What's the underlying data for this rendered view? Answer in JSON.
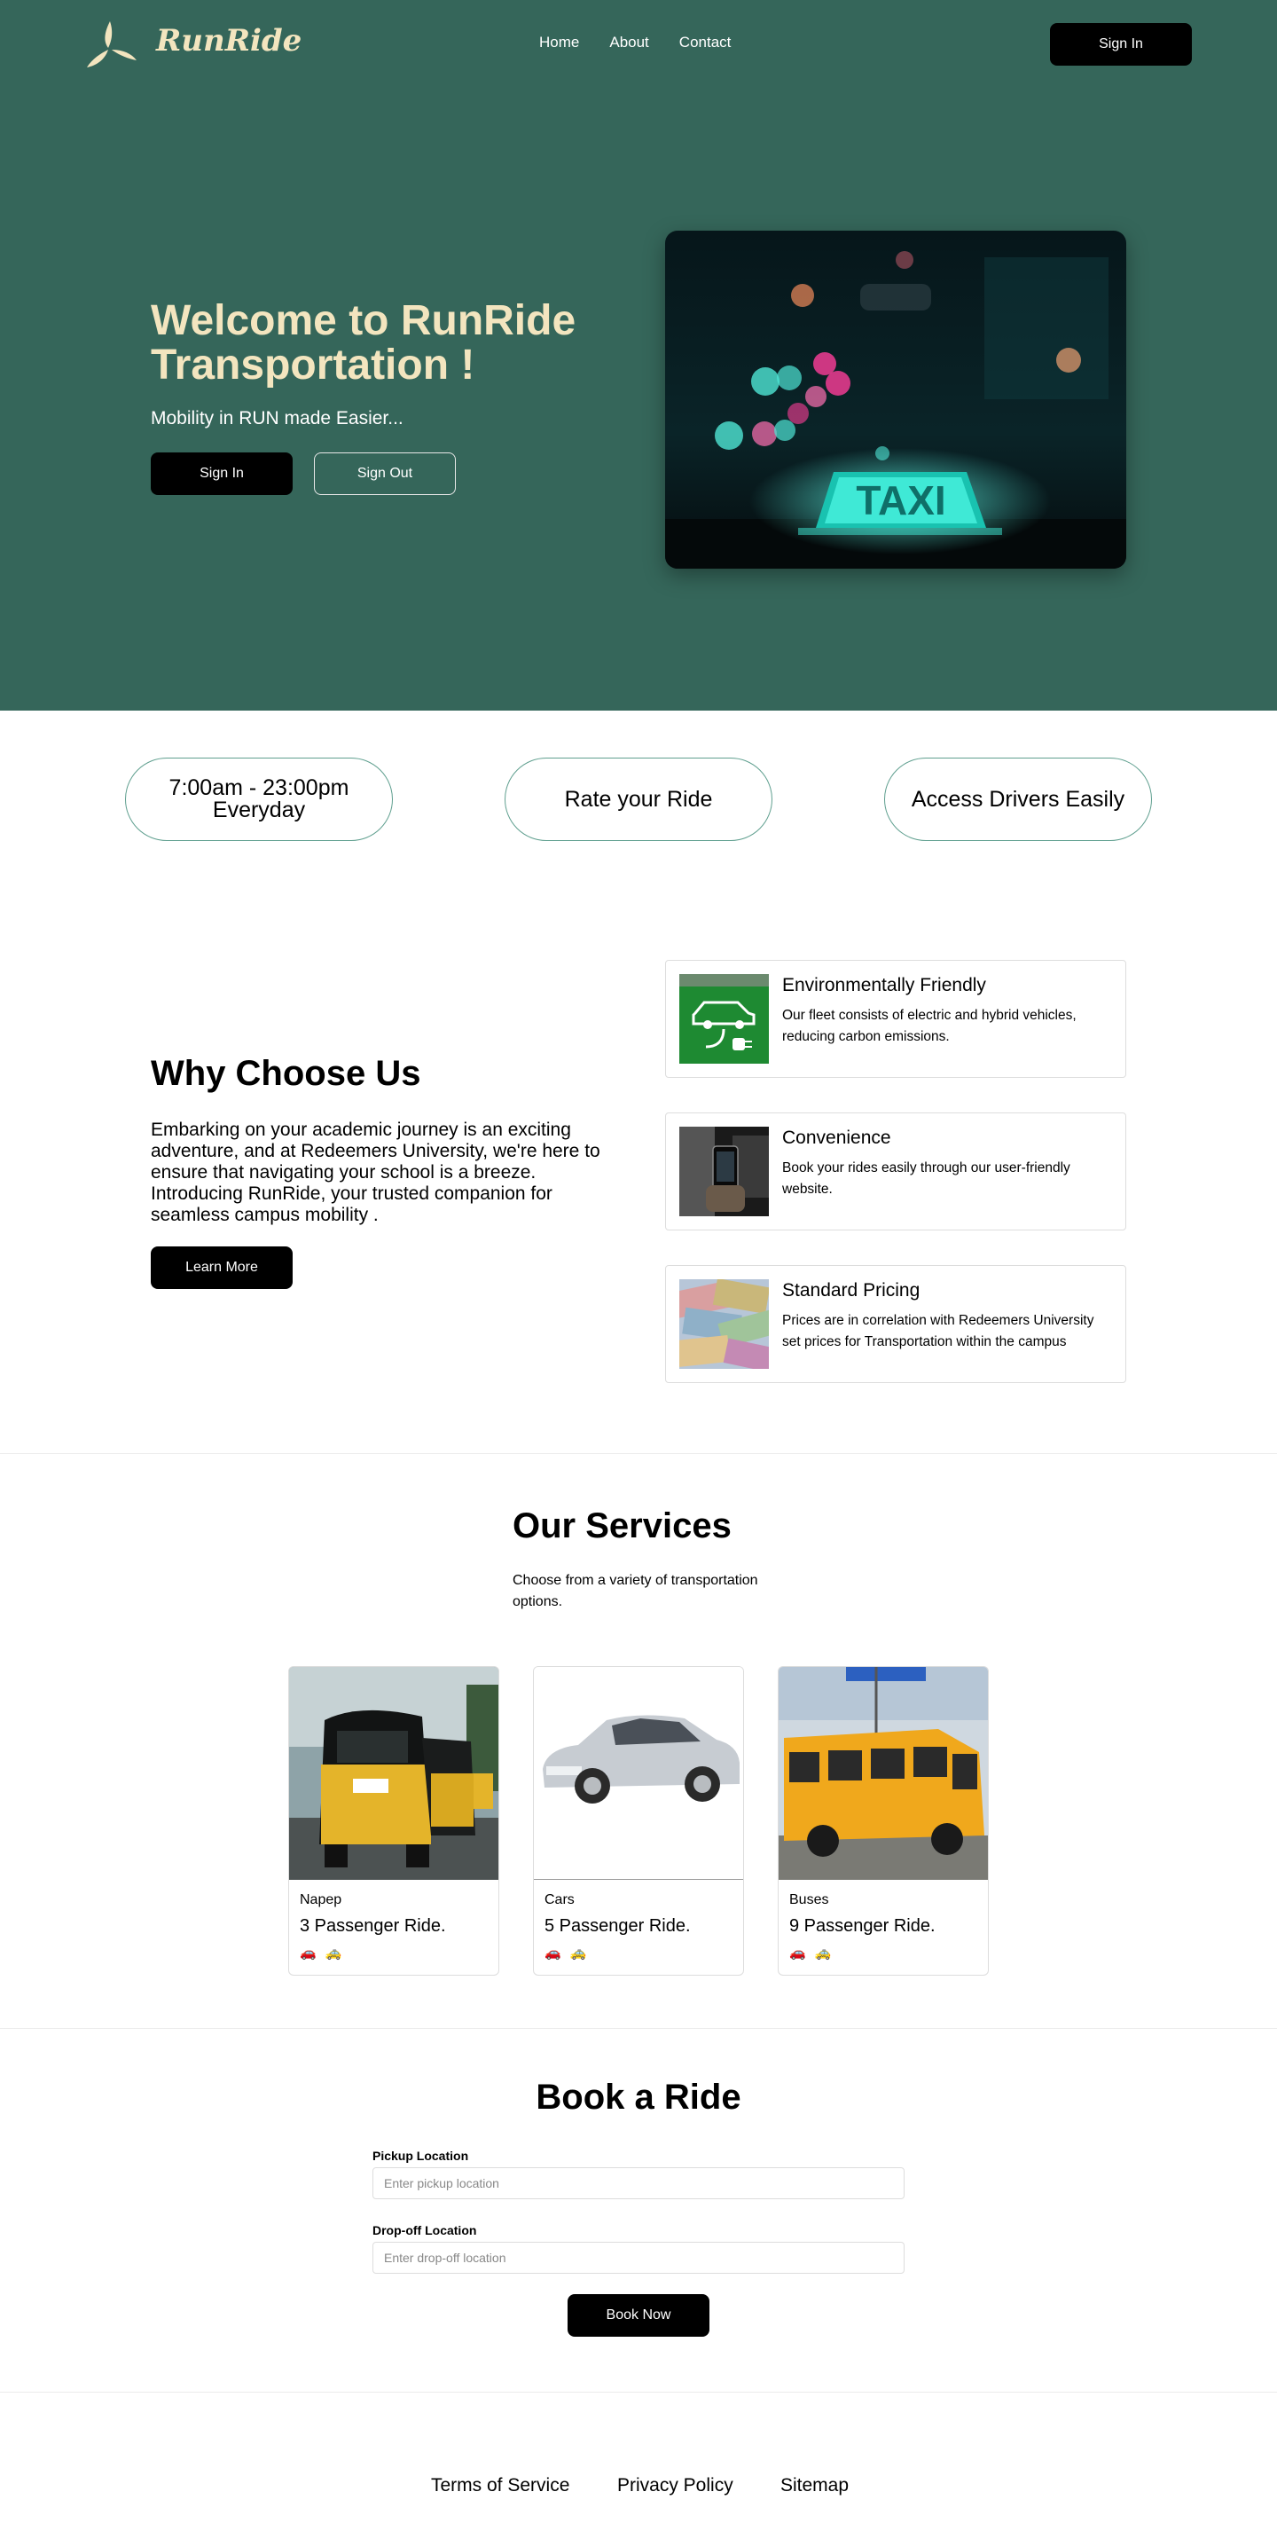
{
  "nav": {
    "brand": "RunRide",
    "links": [
      "Home",
      "About",
      "Contact"
    ],
    "signin_label": "Sign In"
  },
  "hero": {
    "title": "Welcome to RunRide Transportation !",
    "subtitle": "Mobility in RUN made Easier...",
    "signin_label": "Sign In",
    "signout_label": "Sign Out",
    "image_sign_text": "TAXI"
  },
  "pills": [
    {
      "line1": "7:00am - 23:00pm",
      "line2": "Everyday"
    },
    {
      "line1": "Rate your Ride",
      "line2": ""
    },
    {
      "line1": "Access Drivers Easily",
      "line2": ""
    }
  ],
  "why": {
    "title": "Why Choose Us",
    "text": "Embarking on your academic journey is an exciting adventure, and at Redeemers University, we're here to ensure that navigating your school is a breeze. Introducing RunRide, your trusted companion for seamless campus mobility .",
    "learn_label": "Learn More",
    "features": [
      {
        "title": "Environmentally Friendly",
        "text": "Our fleet consists of electric and hybrid vehicles, reducing carbon emissions."
      },
      {
        "title": "Convenience",
        "text": "Book your rides easily through our user-friendly website."
      },
      {
        "title": "Standard Pricing",
        "text": "Prices are in correlation with Redeemers University set prices for Transportation within the campus"
      }
    ]
  },
  "services": {
    "title": "Our Services",
    "subtitle": "Choose from a variety of transportation options.",
    "cards": [
      {
        "category": "Napep",
        "ride": "3 Passenger Ride.",
        "icons": "🚗🚕"
      },
      {
        "category": "Cars",
        "ride": "5 Passenger Ride.",
        "icons": "🚗🚕"
      },
      {
        "category": "Buses",
        "ride": "9 Passenger Ride.",
        "icons": "🚗🚕"
      }
    ]
  },
  "booking": {
    "title": "Book a Ride",
    "pickup_label": "Pickup Location",
    "pickup_placeholder": "Enter pickup location",
    "dropoff_label": "Drop-off Location",
    "dropoff_placeholder": "Enter drop-off location",
    "submit_label": "Book Now"
  },
  "footer": {
    "links": [
      "Terms of Service",
      "Privacy Policy",
      "Sitemap"
    ]
  },
  "colors": {
    "hero_bg": "#35665a",
    "accent_text": "#f3e5bf",
    "pill_border": "#5f9f8f"
  }
}
